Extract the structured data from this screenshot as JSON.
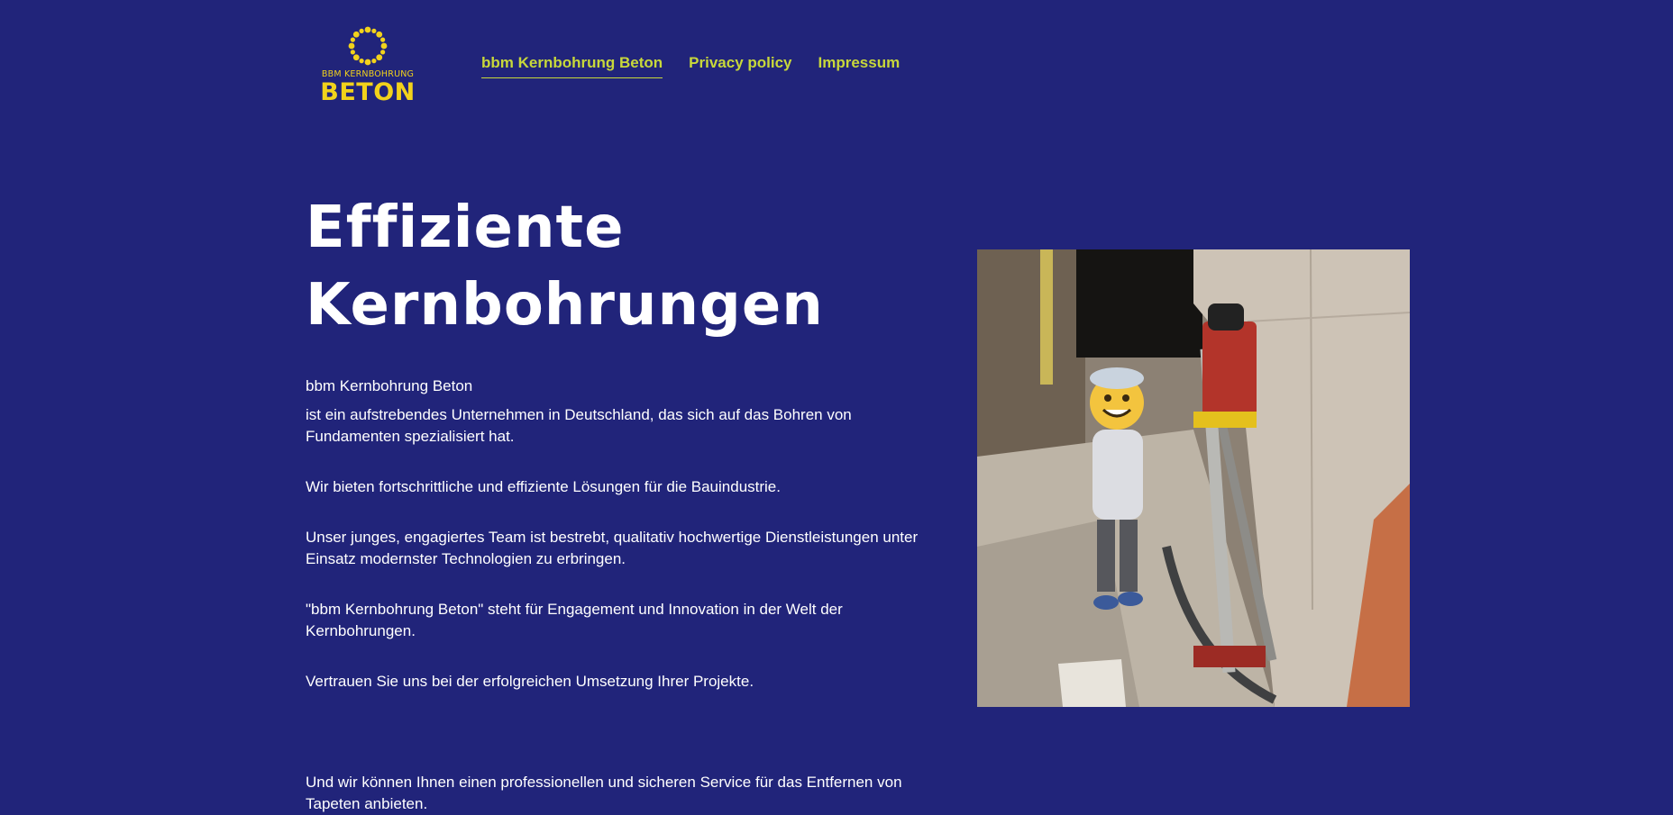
{
  "logo": {
    "small_text": "BBM KERNBOHRUNG",
    "big_text": "BETON",
    "color": "#f2d21b"
  },
  "nav": {
    "items": [
      {
        "label": "bbm Kernbohrung Beton",
        "active": true
      },
      {
        "label": "Privacy policy",
        "active": false
      },
      {
        "label": "Impressum",
        "active": false
      }
    ],
    "color": "#c8d83a"
  },
  "hero": {
    "title_line1": "Effiziente",
    "title_line2": "Kernbohrungen"
  },
  "content": {
    "company": "bbm Kernbohrung Beton",
    "p1": "ist ein aufstrebendes Unternehmen in Deutschland, das sich auf das Bohren von Fundamenten spezialisiert hat.",
    "p2": "Wir bieten fortschrittliche und effiziente Lösungen für die Bauindustrie.",
    "p3": "Unser junges, engagiertes Team ist bestrebt, qualitativ hochwertige Dienstleistungen unter Einsatz modernster Technologien zu erbringen.",
    "p4": " \"bbm Kernbohrung Beton\" steht für Engagement und Innovation in der Welt der Kernbohrungen.",
    "p5": "Vertrauen Sie uns bei der erfolgreichen Umsetzung Ihrer Projekte.",
    "p6": "Und wir können Ihnen einen professionellen und sicheren Service für das Entfernen von Tapeten anbieten."
  },
  "colors": {
    "background": "#21247a",
    "text": "#ffffff"
  }
}
